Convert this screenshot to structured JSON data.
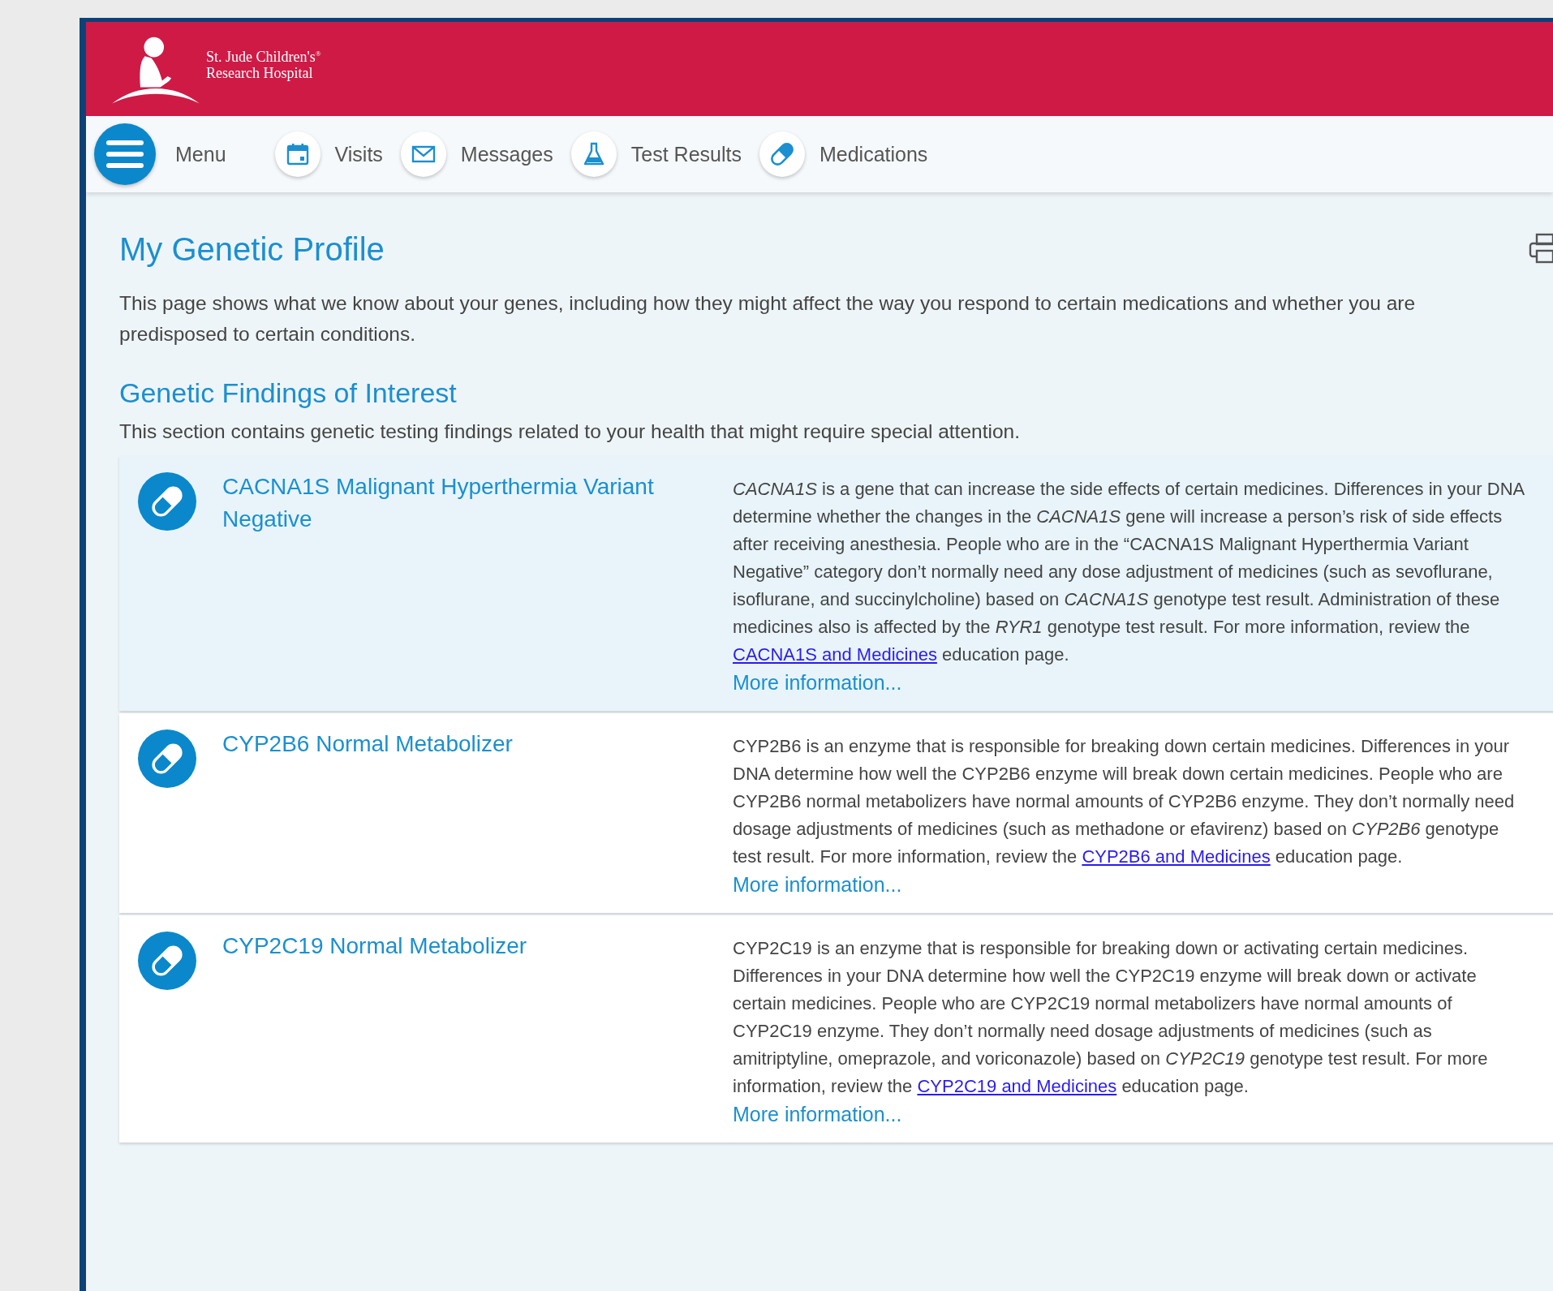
{
  "header": {
    "logo_lines": [
      "St. Jude Children's$^{®}$",
      "Research Hospital"
    ]
  },
  "nav": [
    {
      "kind": "menu",
      "label": "Menu"
    },
    {
      "kind": "calendar",
      "label": "Visits"
    },
    {
      "kind": "mail",
      "label": "Messages"
    },
    {
      "kind": "flask",
      "label": "Test Results"
    },
    {
      "kind": "pills",
      "label": "Medications"
    }
  ],
  "page": {
    "title": "My Genetic Profile",
    "intro": "This page shows what we know about your genes, including how they might affect the way you respond to certain medications and whether you are predisposed to certain conditions."
  },
  "section": {
    "heading": "Genetic Findings of Interest",
    "description": "This section contains genetic testing findings related to your health that might require special attention."
  },
  "findings": [
    {
      "title": "CACNA1S Malignant Hyperthermia Variant Negative",
      "highlighted": true,
      "text_before": "*CACNA1S* is a gene that can increase the side effects of certain medicines. Differences in your DNA determine whether the changes in the *CACNA1S* gene will increase a person’s risk of side effects after receiving anesthesia. People who are in the “CACNA1S Malignant Hyperthermia Variant Negative” category don’t normally need any dose adjustment of medicines (such as sevoflurane, isoflurane, and succinylcholine) based on *CACNA1S* genotype test result. Administration of these medicines also is affected by the *RYR1* genotype test result. For more information, review the",
      "link": "CACNA1S and Medicines",
      "text_after": "education page.",
      "more": "More information..."
    },
    {
      "title": "CYP2B6 Normal Metabolizer",
      "highlighted": false,
      "text_before": "CYP2B6 is an enzyme that is responsible for breaking down certain medicines. Differences in your DNA determine how well the CYP2B6 enzyme will break down certain medicines. People who are CYP2B6 normal metabolizers have normal amounts of CYP2B6 enzyme. They don’t normally need dosage adjustments of medicines (such as methadone or efavirenz) based on *CYP2B6* genotype test result. For more information, review the",
      "link": "CYP2B6 and Medicines",
      "text_after": "education page.",
      "more": "More information..."
    },
    {
      "title": "CYP2C19 Normal Metabolizer",
      "highlighted": false,
      "text_before": "CYP2C19 is an enzyme that is responsible for breaking down or activating certain medicines. Differences in your DNA determine how well the CYP2C19 enzyme will break down or activate certain medicines. People who are CYP2C19 normal metabolizers have normal amounts of CYP2C19 enzyme. They don’t normally need dosage adjustments of medicines (such as amitriptyline, omeprazole, and voriconazole) based on *CYP2C19* genotype test result. For more information, review the",
      "link": "CYP2C19 and Medicines",
      "text_after": "education page.",
      "more": "More information..."
    }
  ]
}
